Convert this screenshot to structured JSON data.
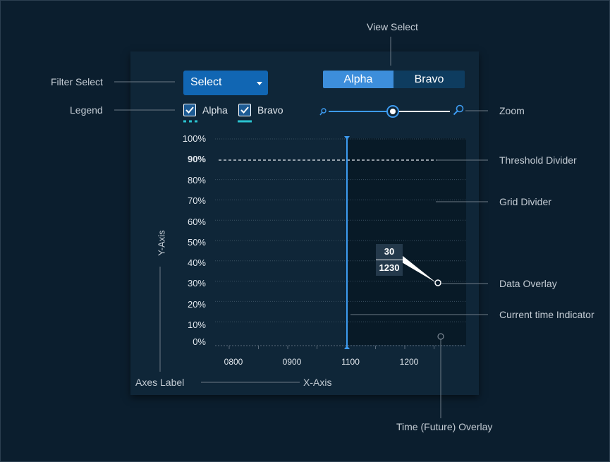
{
  "filter_select": {
    "label": "Select"
  },
  "view_select": {
    "options": [
      "Alpha",
      "Bravo"
    ],
    "selected": "Alpha"
  },
  "legend": {
    "items": [
      {
        "label": "Alpha",
        "checked": true,
        "color": "#2bc4d0",
        "style": "dotted"
      },
      {
        "label": "Bravo",
        "checked": true,
        "color": "#2bc4d0",
        "style": "solid"
      }
    ]
  },
  "zoom": {
    "level": 0.5
  },
  "callouts": {
    "view_select": "View Select",
    "filter_select": "Filter Select",
    "legend": "Legend",
    "zoom": "Zoom",
    "threshold": "Threshold Divider",
    "grid": "Grid Divider",
    "data_overlay": "Data Overlay",
    "current_time": "Current time Indicator",
    "axes_label": "Axes Label",
    "x_axis": "X-Axis",
    "y_axis": "Y-Axis",
    "future_overlay": "Time (Future)  Overlay"
  },
  "chart_data": {
    "type": "line",
    "y_ticks": [
      "100%",
      "90%",
      "80%",
      "70%",
      "60%",
      "50%",
      "40%",
      "30%",
      "20%",
      "10%",
      "0%"
    ],
    "x_ticks": [
      "0800",
      "0900",
      "1100",
      "1200"
    ],
    "threshold": "90%",
    "current_time": "1100",
    "data_overlay": {
      "value": "30",
      "time": "1230"
    },
    "grid": true,
    "colors": {
      "accent": "#3d9bf0",
      "future_region": "#081a27"
    }
  }
}
